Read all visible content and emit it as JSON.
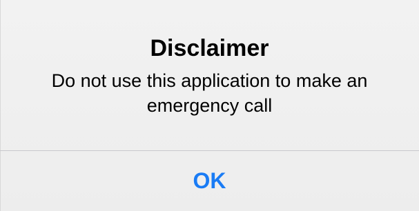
{
  "alert": {
    "title": "Disclaimer",
    "message": "Do not use this application to make an emergency call",
    "ok_label": "OK"
  },
  "colors": {
    "accent": "#1a7cf5"
  }
}
